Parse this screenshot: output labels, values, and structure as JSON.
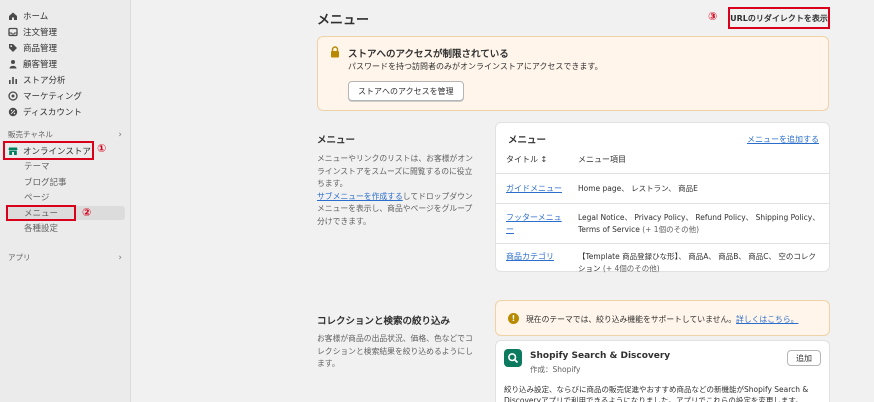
{
  "sidebar": {
    "items": [
      {
        "label": "ホーム",
        "icon": "home-icon"
      },
      {
        "label": "注文管理",
        "icon": "inbox-icon"
      },
      {
        "label": "商品管理",
        "icon": "tag-icon"
      },
      {
        "label": "顧客管理",
        "icon": "person-icon"
      },
      {
        "label": "ストア分析",
        "icon": "bar-chart-icon"
      },
      {
        "label": "マーケティング",
        "icon": "target-icon"
      },
      {
        "label": "ディスカウント",
        "icon": "discount-icon"
      }
    ],
    "sales_channels_label": "販売チャネル",
    "online_store_label": "オンラインストア",
    "sub_items": [
      "テーマ",
      "ブログ記事",
      "ページ",
      "メニュー",
      "各種設定"
    ],
    "apps_label": "アプリ",
    "annotations": [
      "①",
      "②",
      "③"
    ]
  },
  "main": {
    "title": "メニュー",
    "redirect_button": "URLのリダイレクトを表示",
    "banner": {
      "title": "ストアへのアクセスが制限されている",
      "desc": "パスワードを持つ訪問者のみがオンラインストアにアクセスできます。",
      "button": "ストアへのアクセスを管理"
    },
    "menu_section": {
      "heading": "メニュー",
      "desc_line1": "メニューやリンクのリストは、お客様がオンラインストアをスムーズに閲覧するのに役立ちます。",
      "link_text": "サブメニューを作成する",
      "desc_line2": "してドロップダウンメニューを表示し、商品やページをグループ分けできます。"
    },
    "menu_card": {
      "title": "メニュー",
      "add_link": "メニューを追加する",
      "col_title": "タイトル ↕",
      "col_items": "メニュー項目",
      "rows": [
        {
          "title": "ガイドメニュー",
          "items": "Home page、 レストラン、 商品E",
          "more": ""
        },
        {
          "title": "フッターメニュー",
          "items": "Legal Notice、 Privacy Policy、 Refund Policy、 Shipping Policy、 Terms of Service",
          "more": "(+ 1個のその他)"
        },
        {
          "title": "商品カテゴリ",
          "items": "【Template 商品登録ひな形】、 商品A、 商品B、 商品C、 空のコレクション",
          "more": "(+ 4個のその他)"
        }
      ]
    },
    "collection_section": {
      "heading": "コレクションと検索の絞り込み",
      "desc": "お客様が商品の出品状況、価格、色などでコレクションと検索結果を絞り込めるようにします。"
    },
    "info_card": {
      "text": "現在のテーマでは、絞り込み機能をサポートしていません。",
      "link": "詳しくはこちら。"
    },
    "app_card": {
      "name": "Shopify Search & Discovery",
      "by": "作成：Shopify",
      "add_button": "追加",
      "desc": "絞り込み設定、ならびに商品の販売促進やおすすめ商品などの新機能がShopify Search & Discoveryアプリで利用できるようになりました。アプリでこれらの設定を変更します。"
    }
  }
}
